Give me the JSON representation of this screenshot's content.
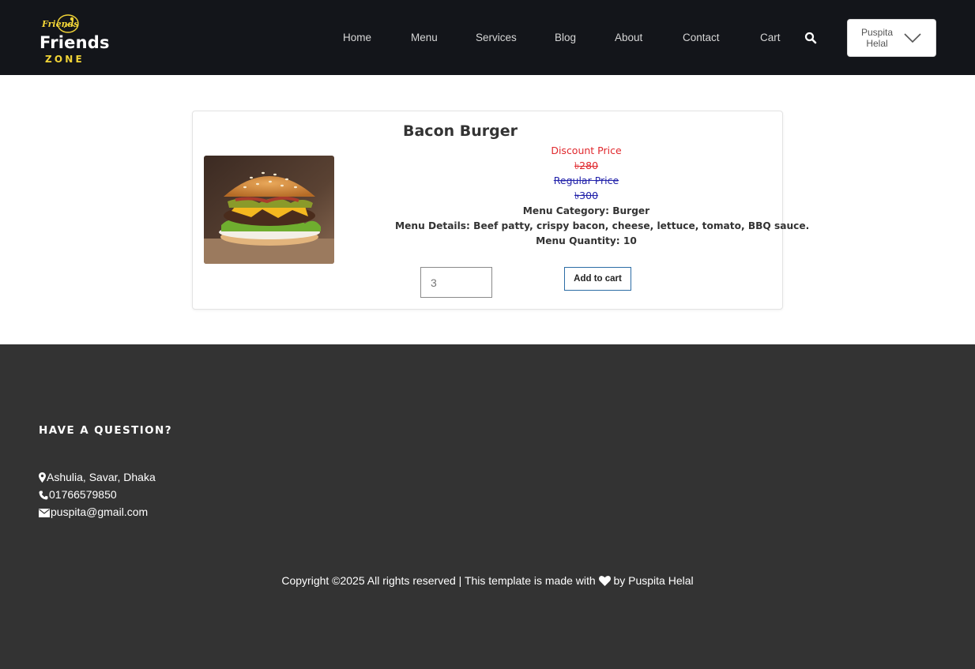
{
  "brand": {
    "badge_text": "Friends",
    "word": "Friends",
    "zone": "ZONE"
  },
  "nav": {
    "links": [
      "Home",
      "Menu",
      "Services",
      "Blog",
      "About",
      "Contact",
      "Cart"
    ],
    "user_name": "Puspita Helal"
  },
  "product": {
    "title": "Bacon Burger",
    "discount_label": "Discount Price",
    "discount_price": "৳280",
    "regular_label": "Regular Price",
    "regular_price": "৳300",
    "category": "Menu Category: Burger",
    "details": "Menu Details: Beef patty, crispy bacon, cheese, lettuce, tomato, BBQ sauce.",
    "quantity": "Menu Quantity: 10",
    "qty_value": "3",
    "add_to_cart": "Add to cart"
  },
  "footer": {
    "heading": "HAVE A QUESTION?",
    "address": "Ashulia, Savar, Dhaka",
    "phone": "01766579850",
    "email": "puspita@gmail.com",
    "copyright_prefix": "Copyright ©2025 All rights reserved | This template is made with",
    "copyright_suffix": "by Puspita Helal"
  },
  "colors": {
    "nav_bg": "#13151a",
    "footer_bg": "#333333",
    "discount": "#e0282d",
    "regular": "#2222aa",
    "accent": "#f1d437",
    "button_border": "#2c6da5"
  },
  "icons": [
    "search-icon",
    "chevron-down-icon",
    "map-pin-icon",
    "phone-icon",
    "envelope-icon",
    "heart-icon"
  ]
}
